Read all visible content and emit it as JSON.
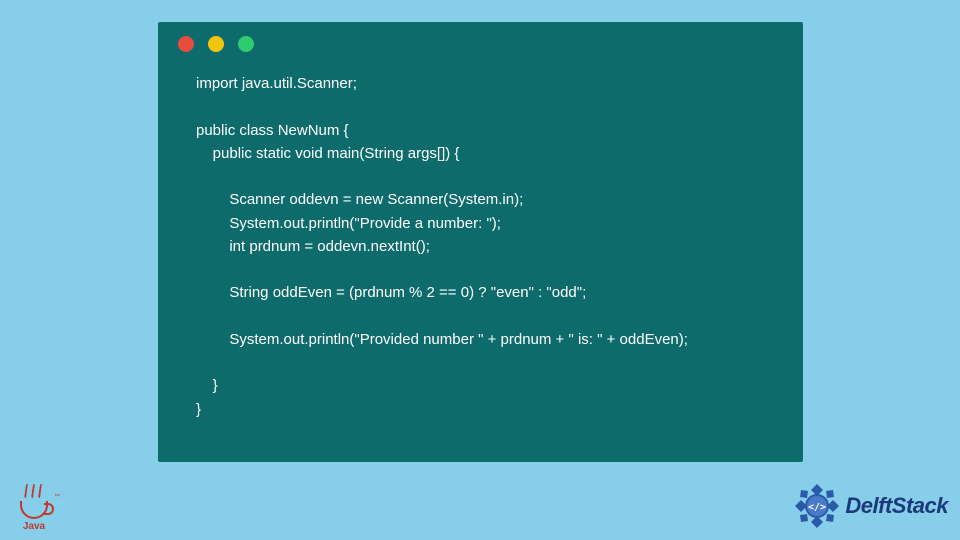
{
  "code": {
    "lines": [
      "import java.util.Scanner;",
      "",
      "public class NewNum {",
      "    public static void main(String args[]) {",
      "",
      "        Scanner oddevn = new Scanner(System.in);",
      "        System.out.println(\"Provide a number: \");",
      "        int prdnum = oddevn.nextInt();",
      "",
      "        String oddEven = (prdnum % 2 == 0) ? \"even\" : \"odd\";",
      "",
      "        System.out.println(\"Provided number \" + prdnum + \" is: \" + oddEven);",
      "",
      "    }",
      "}"
    ]
  },
  "logos": {
    "java_label": "Java",
    "java_tm": "™",
    "brand_name": "DelftStack"
  },
  "colors": {
    "page_bg": "#87ceeb",
    "window_bg": "#0e6b6b",
    "code_text": "#ffffff",
    "dot_red": "#e74c3c",
    "dot_yellow": "#f1c40f",
    "dot_green": "#2ecc71",
    "java_color": "#c0392b",
    "brand_color": "#1a3a7a"
  }
}
